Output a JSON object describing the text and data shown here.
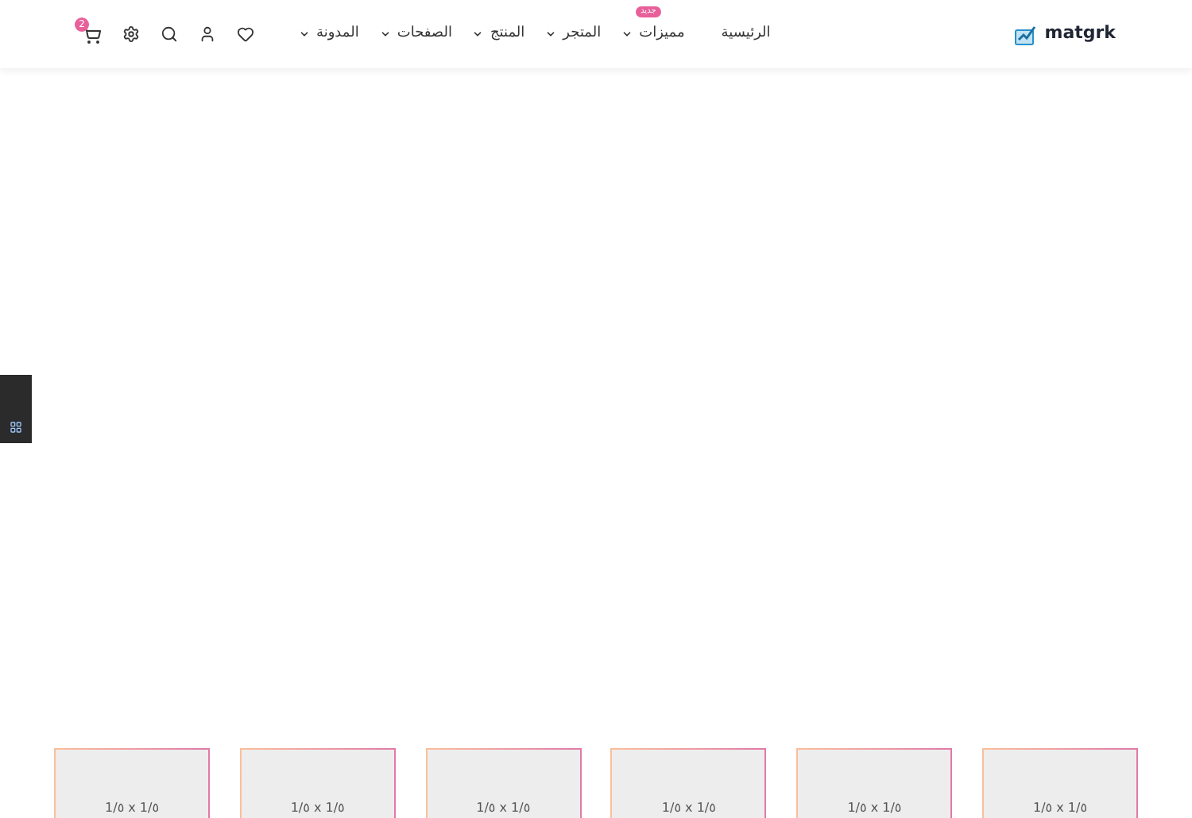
{
  "header": {
    "logo": "matgrk",
    "nav": [
      {
        "label": "الرئيسية",
        "dropdown": false
      },
      {
        "label": "مميزات",
        "dropdown": true,
        "badge": "جديد"
      },
      {
        "label": "المتجر",
        "dropdown": true
      },
      {
        "label": "المنتج",
        "dropdown": true
      },
      {
        "label": "الصفحات",
        "dropdown": true
      },
      {
        "label": "المدونة",
        "dropdown": true
      }
    ],
    "cart_count": "2"
  },
  "cards": [
    {
      "label": "1/٥ x 1/٥"
    },
    {
      "label": "1/٥ x 1/٥"
    },
    {
      "label": "1/٥ x 1/٥"
    },
    {
      "label": "1/٥ x 1/٥"
    },
    {
      "label": "1/٥ x 1/٥"
    },
    {
      "label": "1/٥ x 1/٥"
    }
  ]
}
